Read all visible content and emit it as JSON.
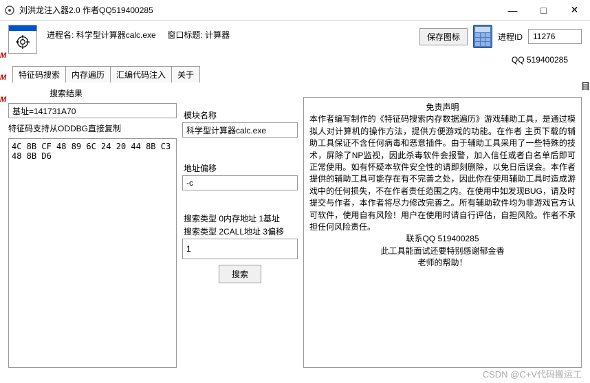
{
  "window": {
    "title": "刘洪龙注入器2.0 作者QQ519400285",
    "minimize": "—",
    "maximize": "□",
    "close": "✕"
  },
  "header": {
    "process_label": "进程名:",
    "process_name": "科学型计算器calc.exe",
    "wintitle_label": "窗口标题:",
    "wintitle_value": "计算器",
    "save_icon_btn": "保存图标",
    "pid_label": "进程ID",
    "pid_value": "11276",
    "qq_line": "QQ 519400285"
  },
  "tabs": [
    {
      "label": "特征码搜索",
      "active": true
    },
    {
      "label": "内存遍历",
      "active": false
    },
    {
      "label": "汇编代码注入",
      "active": false
    },
    {
      "label": "关于",
      "active": false
    }
  ],
  "left": {
    "results_label": "搜索结果",
    "base_input_value": "基址=141731A70",
    "oddbg_note": "特征码支持从ODDBG直接复制",
    "results_text": "4C 8B CF 48 89 6C 24 20 44 8B C3 48 8B D6"
  },
  "mid": {
    "module_label": "模块名称",
    "module_value": "科学型计算器calc.exe",
    "offset_label": "地址偏移",
    "offset_value": "-c",
    "search_type_line1": "搜索类型 0内存地址  1基址",
    "search_type_line2": "搜索类型 2CALL地址  3偏移",
    "search_type_value": "1",
    "search_btn": "搜索"
  },
  "disclaimer": {
    "title": "免责声明",
    "body": "本作者编写制作的《特征码搜索内存数据遍历》游戏辅助工具，是通过模拟人对计算机的操作方法，提供方便游戏的功能。在作者 主页下载的辅助工具保证不含任何病毒和恶意插件。由于辅助工具采用了一些特殊的技术，屏除了NP监视，因此杀毒软件会报警，加入信任或者白名单后即可正常使用。如有怀疑本软件安全性的请即刻删除，以免日后误会。本作者提供的辅助工具可能存在有不完善之处，因此你在使用辅助工具时造成游戏中的任何损失，不在作者责任范围之内。在使用中如发现BUG，请及时提交与作者，本作者将尽力修改完善之。所有辅助软件均为非游戏官方认可软件，使用自有风险！用户在使用时请自行评估，自担风险。作者不承担任何风险责任。",
    "contact": "联系QQ 519400285",
    "thanks1": "此工具能面试还要特别感谢郁金香",
    "thanks2": "老师的帮助！"
  },
  "watermark": "CSDN @C+V代码搬运工",
  "side_marks": [
    "M",
    "M",
    "M"
  ],
  "right_frag": "目"
}
